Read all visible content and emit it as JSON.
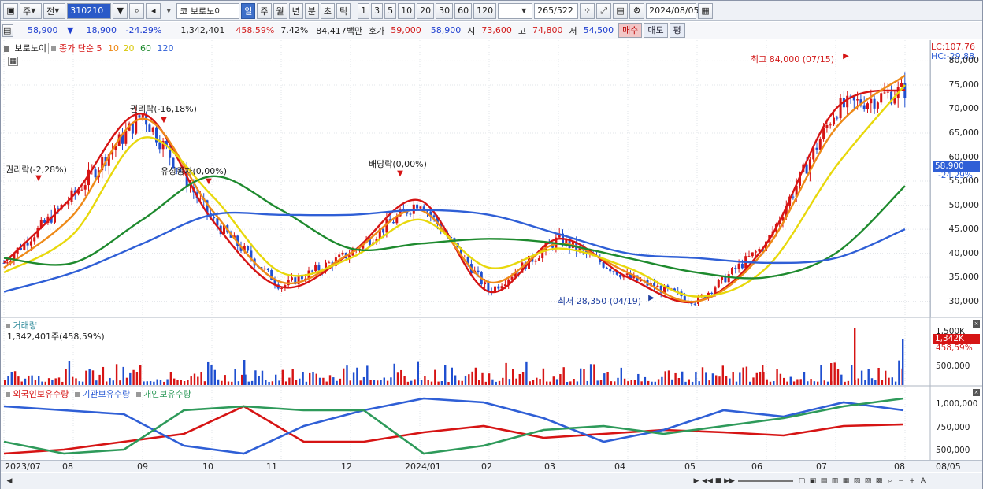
{
  "toolbar": {
    "period": "주",
    "adj": "전",
    "code": "310210",
    "name_prefix": "코",
    "name": "보로노이",
    "intervals": [
      "일",
      "주",
      "월",
      "년",
      "분",
      "초",
      "틱"
    ],
    "ticks": [
      "1",
      "3",
      "5",
      "10",
      "20",
      "30",
      "60",
      "120"
    ],
    "count": "265",
    "total": "/522",
    "date": "2024/08/05"
  },
  "quote": {
    "price": "58,900",
    "arrow": "▼",
    "change": "18,900",
    "rate": "-24.29%",
    "volume": "1,342,401",
    "vol_ratio": "458.59%",
    "turnover": "7.42%",
    "amount": "84,417백만",
    "ask_label": "호가",
    "ask": "59,000",
    "bid": "58,900",
    "open_label": "시",
    "open": "73,600",
    "high_label": "고",
    "high": "74,800",
    "low_label": "저",
    "low": "54,500",
    "buy": "매수",
    "sell": "매도",
    "eval": "평"
  },
  "price_panel": {
    "name": "보로노이",
    "ma_label": "종가 단순",
    "ma": [
      "5",
      "10",
      "20",
      "60",
      "120"
    ],
    "ma_colors": [
      "#d61414",
      "#ee8a18",
      "#e8d80c",
      "#1e8a2e",
      "#2f5fd6"
    ],
    "lc": "LC:107.76",
    "hc": "HC:-29.88",
    "y_ticks": [
      "80,000",
      "75,000",
      "70,000",
      "65,000",
      "60,000",
      "55,000",
      "50,000",
      "45,000",
      "40,000",
      "35,000",
      "30,000"
    ],
    "cur_price": "58,900",
    "cur_rate": "-24.29%",
    "ann_high": "최고 84,000 (07/15)",
    "ann_low": "최저 28,350 (04/19)",
    "ann_rights1": "권리락(-2,28%)",
    "ann_rights2": "권리락(-16,18%)",
    "ann_bonus": "유상증자(0,00%)",
    "ann_div": "배당락(0,00%)"
  },
  "volume_panel": {
    "title": "거래량",
    "value": "1,342,401주(458,59%)",
    "y_ticks": [
      "1,500K",
      "500,000"
    ],
    "cur": "1,342K",
    "cur_rate": "458,59%"
  },
  "holding_panel": {
    "series": [
      "외국인보유수량",
      "기관보유수량",
      "개인보유수량"
    ],
    "colors": [
      "#d61414",
      "#2f5fd6",
      "#2e9a5a"
    ],
    "y_ticks": [
      "1,000,000",
      "750,000",
      "500,000"
    ]
  },
  "x_axis": {
    "labels": [
      "2023/07",
      "08",
      "09",
      "10",
      "11",
      "12",
      "2024/01",
      "02",
      "03",
      "04",
      "05",
      "06",
      "07",
      "08",
      "08/05"
    ]
  },
  "chart_data": {
    "type": "line",
    "x": [
      "2023/07",
      "08",
      "09",
      "10",
      "11",
      "12",
      "2024/01",
      "02",
      "03",
      "04",
      "05",
      "06",
      "07",
      "08"
    ],
    "series": [
      {
        "name": "5",
        "values": [
          38000,
          52000,
          69000,
          47000,
          33000,
          40000,
          51000,
          32000,
          43000,
          35000,
          30000,
          42000,
          70000,
          74000
        ]
      },
      {
        "name": "10",
        "values": [
          37000,
          48000,
          68000,
          49000,
          34000,
          40000,
          49000,
          34000,
          42000,
          36000,
          30000,
          41000,
          66000,
          77000
        ]
      },
      {
        "name": "20",
        "values": [
          36000,
          44000,
          64000,
          52000,
          36000,
          39000,
          47000,
          37000,
          41000,
          37000,
          31000,
          37000,
          58000,
          75000
        ]
      },
      {
        "name": "60",
        "values": [
          39000,
          38000,
          47000,
          56000,
          49000,
          41000,
          42000,
          43000,
          42000,
          39000,
          36000,
          35000,
          40000,
          54000
        ]
      },
      {
        "name": "120",
        "values": [
          32000,
          36000,
          42000,
          48000,
          48000,
          48000,
          49000,
          48000,
          44000,
          40000,
          39000,
          38000,
          39000,
          45000
        ]
      }
    ],
    "ylim": [
      27000,
      84000
    ]
  }
}
